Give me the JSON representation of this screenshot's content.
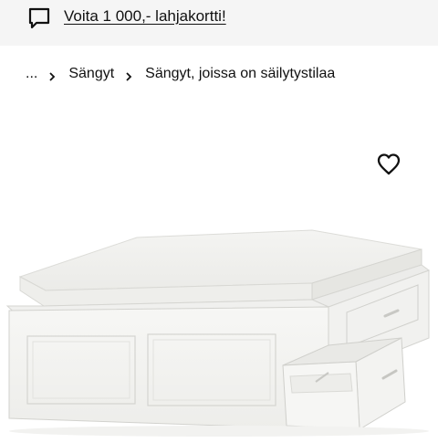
{
  "promo": {
    "icon": "chat-bubble-icon",
    "link_text": "Voita 1 000,- lahjakortti!"
  },
  "breadcrumb": {
    "items": [
      {
        "label": "..."
      },
      {
        "label": "Sängyt"
      },
      {
        "label": "Sängyt, joissa on säilytystilaa"
      }
    ],
    "separator_icon": "chevron-right-icon"
  },
  "product": {
    "favourite_icon": "heart-outline-icon",
    "image": "white-bed-frame-with-storage-drawers"
  }
}
